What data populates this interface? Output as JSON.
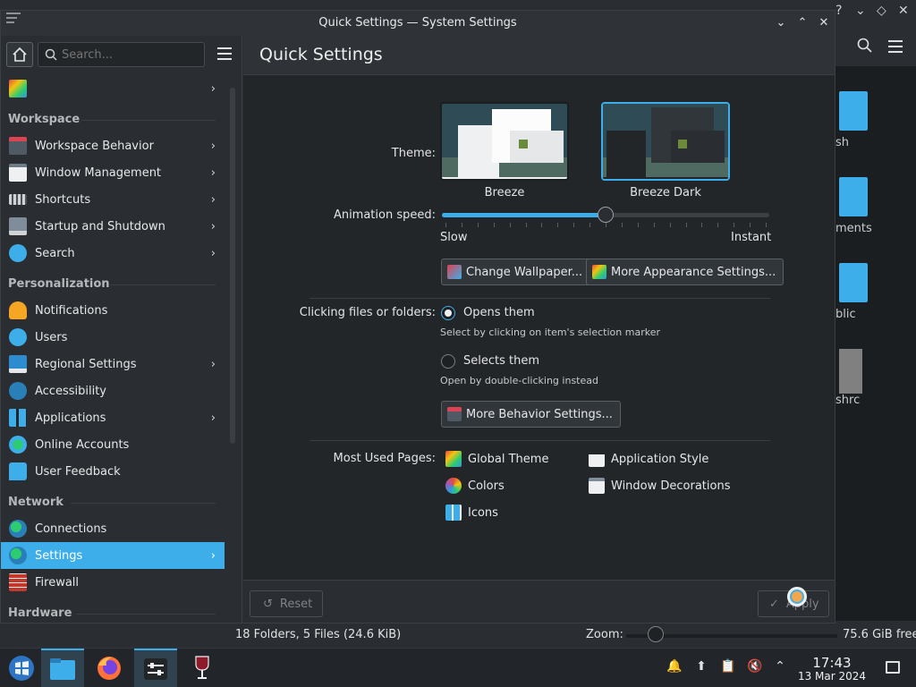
{
  "window": {
    "title": "Quick Settings — System Settings"
  },
  "sidebar": {
    "search_placeholder": "Search...",
    "groups": [
      {
        "heading": "",
        "items": [
          {
            "label": "",
            "icon": "global-theme-icon",
            "chevron": true
          }
        ]
      },
      {
        "heading": "Workspace",
        "items": [
          {
            "label": "Workspace Behavior",
            "icon": "workspace-behavior-icon",
            "chevron": true
          },
          {
            "label": "Window Management",
            "icon": "window-management-icon",
            "chevron": true
          },
          {
            "label": "Shortcuts",
            "icon": "keyboard-icon",
            "chevron": true
          },
          {
            "label": "Startup and Shutdown",
            "icon": "startup-icon",
            "chevron": true
          },
          {
            "label": "Search",
            "icon": "search-icon",
            "chevron": true
          }
        ]
      },
      {
        "heading": "Personalization",
        "items": [
          {
            "label": "Notifications",
            "icon": "bell-icon",
            "chevron": false
          },
          {
            "label": "Users",
            "icon": "users-icon",
            "chevron": false
          },
          {
            "label": "Regional Settings",
            "icon": "regional-icon",
            "chevron": true
          },
          {
            "label": "Accessibility",
            "icon": "accessibility-icon",
            "chevron": false
          },
          {
            "label": "Applications",
            "icon": "applications-icon",
            "chevron": true
          },
          {
            "label": "Online Accounts",
            "icon": "online-accounts-icon",
            "chevron": false
          },
          {
            "label": "User Feedback",
            "icon": "feedback-icon",
            "chevron": false
          }
        ]
      },
      {
        "heading": "Network",
        "items": [
          {
            "label": "Connections",
            "icon": "globe-icon",
            "chevron": false
          },
          {
            "label": "Settings",
            "icon": "network-settings-icon",
            "chevron": true,
            "selected": true
          },
          {
            "label": "Firewall",
            "icon": "firewall-icon",
            "chevron": false
          }
        ]
      },
      {
        "heading": "Hardware",
        "items": []
      }
    ]
  },
  "page": {
    "title": "Quick Settings",
    "theme_label": "Theme:",
    "themes": [
      {
        "name": "Breeze",
        "selected": false
      },
      {
        "name": "Breeze Dark",
        "selected": true
      }
    ],
    "animation_label": "Animation speed:",
    "animation_value_percent": 50,
    "slow_label": "Slow",
    "instant_label": "Instant",
    "change_wallpaper": "Change Wallpaper...",
    "more_appearance": "More Appearance Settings...",
    "clicking_label": "Clicking files or folders:",
    "opens_label": "Opens them",
    "opens_hint": "Select by clicking on item's selection marker",
    "selects_label": "Selects them",
    "selects_hint": "Open by double-clicking instead",
    "more_behavior": "More Behavior Settings...",
    "most_used_label": "Most Used Pages:",
    "most_used": [
      {
        "label": "Global Theme",
        "icon": "global-theme-icon"
      },
      {
        "label": "Application Style",
        "icon": "application-style-icon"
      },
      {
        "label": "Colors",
        "icon": "colors-icon"
      },
      {
        "label": "Window Decorations",
        "icon": "window-decorations-icon"
      },
      {
        "label": "Icons",
        "icon": "icons-icon"
      }
    ]
  },
  "footer": {
    "reset": "Reset",
    "apply": "Apply"
  },
  "background_window": {
    "files": [
      "sh",
      "ments",
      "blic",
      "shrc"
    ],
    "status": "18 Folders, 5 Files (24.6 KiB)",
    "zoom_label": "Zoom:",
    "free_space": "75.6 GiB free"
  },
  "taskbar": {
    "time": "17:43",
    "date": "13 Mar 2024"
  },
  "colors": {
    "accent": "#3daee9",
    "window_bg": "#2a2e32",
    "view_bg": "#232629"
  }
}
